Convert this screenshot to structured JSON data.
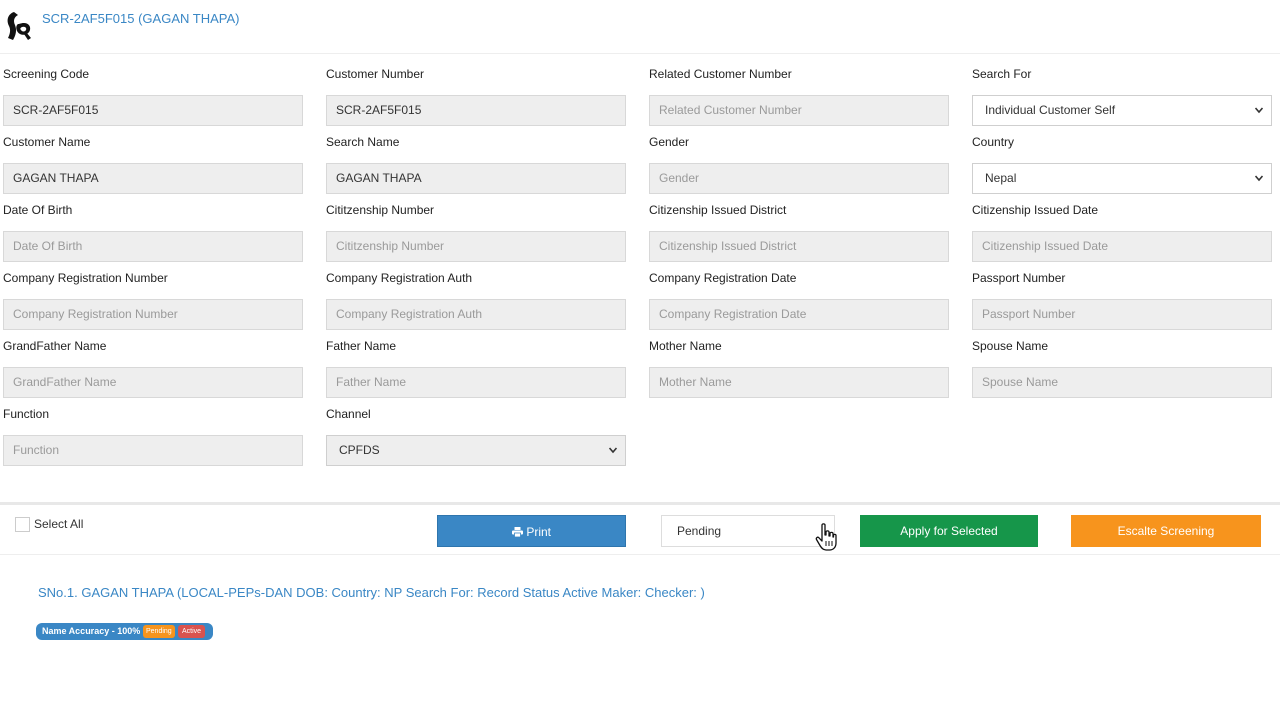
{
  "header": {
    "title": "SCR-2AF5F015 (GAGAN THAPA)"
  },
  "fields": {
    "screening_code": {
      "label": "Screening Code",
      "value": "SCR-2AF5F015"
    },
    "customer_number": {
      "label": "Customer Number",
      "value": "SCR-2AF5F015"
    },
    "related_customer_number": {
      "label": "Related Customer Number",
      "placeholder": "Related Customer Number"
    },
    "search_for": {
      "label": "Search For",
      "value": "Individual Customer Self"
    },
    "customer_name": {
      "label": "Customer Name",
      "value": "GAGAN THAPA"
    },
    "search_name": {
      "label": "Search Name",
      "value": "GAGAN THAPA"
    },
    "gender": {
      "label": "Gender",
      "placeholder": "Gender"
    },
    "country": {
      "label": "Country",
      "value": "Nepal"
    },
    "date_of_birth": {
      "label": "Date Of Birth",
      "placeholder": "Date Of Birth"
    },
    "citizenship_number": {
      "label": "Cititzenship Number",
      "placeholder": "Cititzenship Number"
    },
    "citizenship_issued_district": {
      "label": "Citizenship Issued District",
      "placeholder": "Citizenship Issued District"
    },
    "citizenship_issued_date": {
      "label": "Citizenship Issued Date",
      "placeholder": "Citizenship Issued Date"
    },
    "company_registration_number": {
      "label": "Company Registration Number",
      "placeholder": "Company Registration Number"
    },
    "company_registration_auth": {
      "label": "Company Registration Auth",
      "placeholder": "Company Registration Auth"
    },
    "company_registration_date": {
      "label": "Company Registration Date",
      "placeholder": "Company Registration Date"
    },
    "passport_number": {
      "label": "Passport Number",
      "placeholder": "Passport Number"
    },
    "grandfather_name": {
      "label": "GrandFather Name",
      "placeholder": "GrandFather Name"
    },
    "father_name": {
      "label": "Father Name",
      "placeholder": "Father Name"
    },
    "mother_name": {
      "label": "Mother Name",
      "placeholder": "Mother Name"
    },
    "spouse_name": {
      "label": "Spouse Name",
      "placeholder": "Spouse Name"
    },
    "function": {
      "label": "Function",
      "placeholder": "Function"
    },
    "channel": {
      "label": "Channel",
      "value": "CPFDS"
    }
  },
  "actions": {
    "select_all_label": "Select All",
    "print_label": "Print",
    "status_value": "Pending",
    "apply_label": "Apply for Selected",
    "escalate_label": "Escalte Screening"
  },
  "record": {
    "title": "SNo.1. GAGAN THAPA (LOCAL-PEPs-DAN DOB: Country: NP Search For: Record Status Active Maker: Checker: )",
    "accuracy_badge": "Name Accuracy - 100%",
    "pending_badge": "Pending",
    "active_badge": "Active"
  },
  "icons": {
    "logo": "brand-logo-icon",
    "print": "printer-icon",
    "chevron": "chevron-down-icon",
    "cursor": "hand-pointer-cursor"
  },
  "colors": {
    "accent": "#3a87c5",
    "apply": "#16964a",
    "escalate": "#f7941d",
    "active": "#d9534f"
  }
}
